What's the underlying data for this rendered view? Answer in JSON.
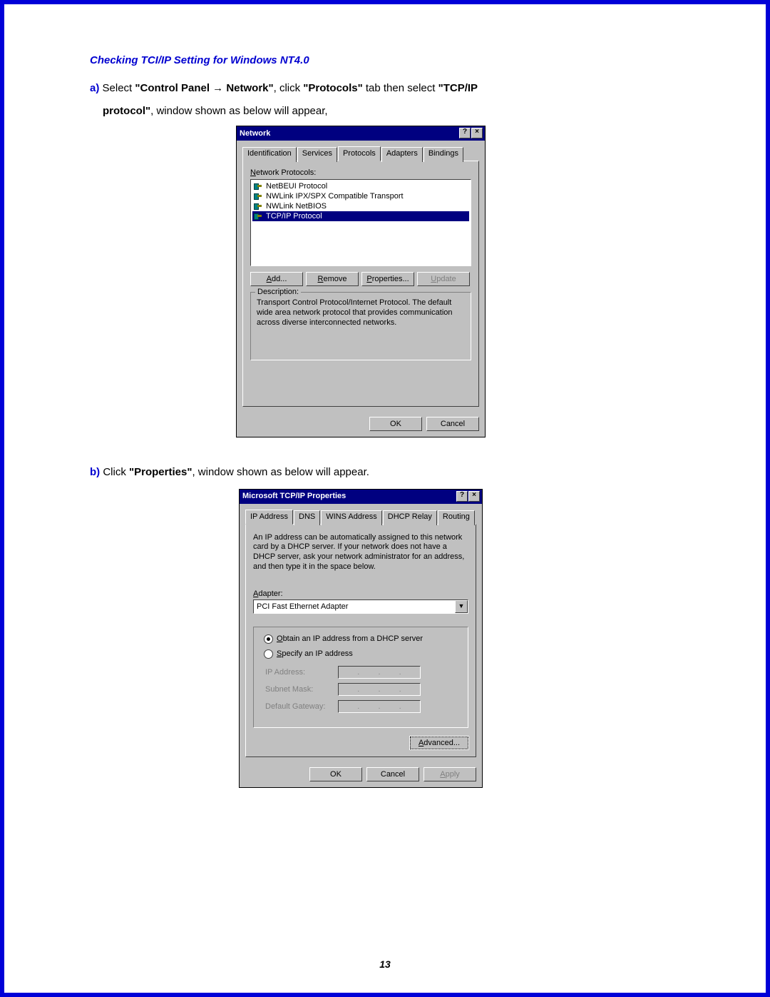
{
  "section_title": "Checking TCI/IP Setting for Windows NT4.0",
  "instr_a": {
    "marker": "a)",
    "t1": " Select ",
    "bold1": "\"Control Panel → Network\"",
    "t2": ", click ",
    "bold2": "\"Protocols\"",
    "t3": " tab then select ",
    "bold3": "\"TCP/IP",
    "line2_bold": "protocol\"",
    "line2_rest": ", window shown as below will appear,"
  },
  "dlg1": {
    "title": "Network",
    "help": "?",
    "close": "×",
    "tabs": [
      "Identification",
      "Services",
      "Protocols",
      "Adapters",
      "Bindings"
    ],
    "active_tab_index": 2,
    "list_label": "Network Protocols:",
    "protocols": [
      "NetBEUI Protocol",
      "NWLink IPX/SPX Compatible Transport",
      "NWLink NetBIOS",
      "TCP/IP Protocol"
    ],
    "selected_index": 3,
    "buttons": {
      "add": "Add...",
      "remove": "Remove",
      "properties": "Properties...",
      "update": "Update"
    },
    "desc_title": "Description:",
    "desc_text": "Transport Control Protocol/Internet Protocol. The default wide area network protocol that provides communication across diverse interconnected networks.",
    "ok": "OK",
    "cancel": "Cancel"
  },
  "instr_b": {
    "marker": "b)",
    "t1": " Click ",
    "bold1": "\"Properties\"",
    "t2": ", window shown as below will appear."
  },
  "dlg2": {
    "title": "Microsoft TCP/IP Properties",
    "help": "?",
    "close": "×",
    "tabs": [
      "IP Address",
      "DNS",
      "WINS Address",
      "DHCP Relay",
      "Routing"
    ],
    "active_tab_index": 0,
    "info": "An IP address can be automatically assigned to this network card by a DHCP server. If your network does not have a DHCP server, ask your network administrator for an address, and then type it in the space below.",
    "adapter_label": "Adapter:",
    "adapter_value": "PCI Fast Ethernet Adapter",
    "radio1": "Obtain an IP address from a DHCP server",
    "radio2": "Specify an IP address",
    "ip_label": "IP Address:",
    "mask_label": "Subnet Mask:",
    "gw_label": "Default Gateway:",
    "advanced": "Advanced...",
    "ok": "OK",
    "cancel": "Cancel",
    "apply": "Apply"
  },
  "page_number": "13"
}
